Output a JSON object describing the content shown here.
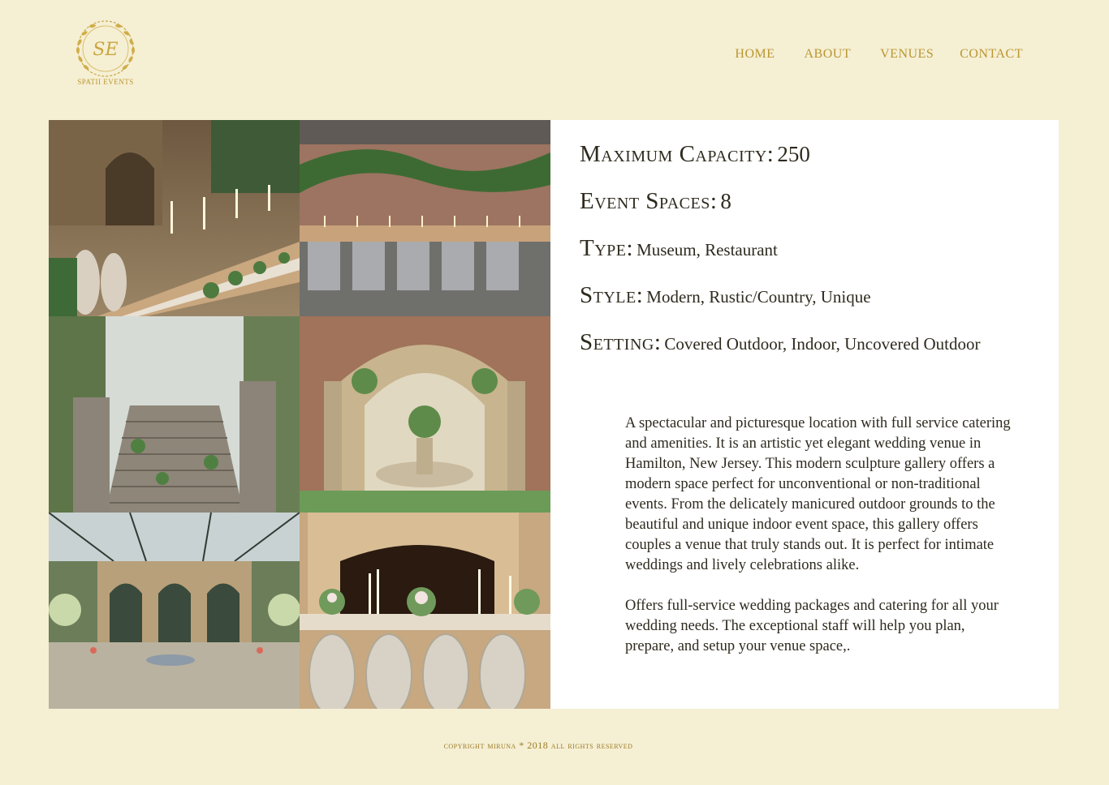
{
  "logo": {
    "monogram": "SE",
    "caption": "SPATII EVENTS"
  },
  "nav": {
    "home": "HOME",
    "about": "ABOUT",
    "venues": "VENUES",
    "contact": "CONTACT"
  },
  "venue": {
    "facts": {
      "capacity_label": "Maximum Capacity:",
      "capacity_value": "250",
      "spaces_label": "Event Spaces:",
      "spaces_value": "8",
      "type_label": "Type:",
      "type_value": "Museum, Restaurant",
      "style_label": "Style:",
      "style_value": "Modern, Rustic/Country, Unique",
      "setting_label": "Setting:",
      "setting_value": "Covered Outdoor, Indoor, Uncovered Outdoor"
    },
    "description": [
      "A spectacular and picturesque location with full service catering and amenities. It is an artistic yet elegant wedding venue in Hamilton, New Jersey.  This modern sculpture gallery offers a modern space perfect for unconventional or non-traditional  events. From the delicately manicured outdoor grounds to the beautiful and unique indoor event space, this gallery offers couples a venue that truly stands out. It is perfect for intimate weddings and lively celebrations alike.",
      "Offers full-service wedding packages and catering for all your wedding needs. The exceptional staff  will help you plan, prepare, and setup your venue space,."
    ]
  },
  "footer": {
    "copyright": "copyright miruna * 2018 all rights reserved"
  },
  "colors": {
    "background": "#f5efd4",
    "gold": "#b9962f",
    "text": "#2e2a1e",
    "panel": "#ffffff"
  }
}
